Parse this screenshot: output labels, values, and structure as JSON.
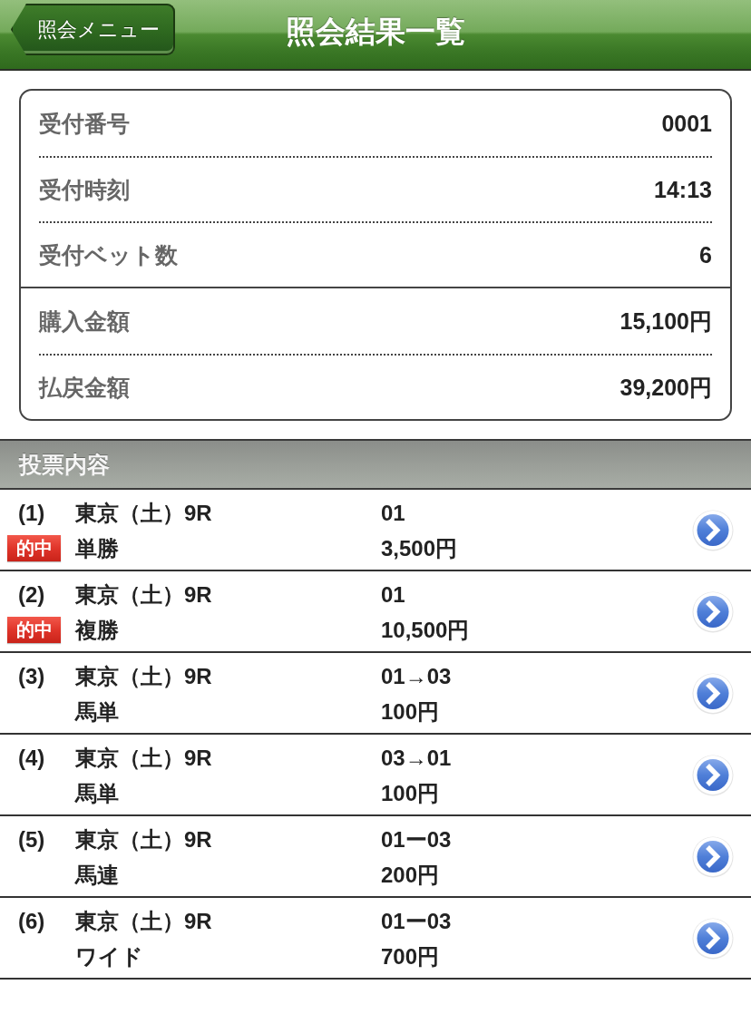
{
  "header": {
    "back_button": "照会メニュー",
    "title": "照会結果一覧"
  },
  "summary": {
    "groups": [
      {
        "rows": [
          {
            "label": "受付番号",
            "value": "0001"
          },
          {
            "label": "受付時刻",
            "value": "14:13"
          },
          {
            "label": "受付ベット数",
            "value": "6"
          }
        ]
      },
      {
        "rows": [
          {
            "label": "購入金額",
            "value": "15,100円"
          },
          {
            "label": "払戻金額",
            "value": "39,200円"
          }
        ]
      }
    ]
  },
  "section": {
    "title": "投票内容"
  },
  "bets": [
    {
      "number": "(1)",
      "badge": "的中",
      "venue": "東京（土）9R",
      "bet_type": "単勝",
      "combination": "01",
      "amount": "3,500円"
    },
    {
      "number": "(2)",
      "badge": "的中",
      "venue": "東京（土）9R",
      "bet_type": "複勝",
      "combination": "01",
      "amount": "10,500円"
    },
    {
      "number": "(3)",
      "venue": "東京（土）9R",
      "bet_type": "馬単",
      "combination": "01→03",
      "amount": "100円"
    },
    {
      "number": "(4)",
      "venue": "東京（土）9R",
      "bet_type": "馬単",
      "combination": "03→01",
      "amount": "100円"
    },
    {
      "number": "(5)",
      "venue": "東京（土）9R",
      "bet_type": "馬連",
      "combination": "01ー03",
      "amount": "200円"
    },
    {
      "number": "(6)",
      "venue": "東京（土）9R",
      "bet_type": "ワイド",
      "combination": "01ー03",
      "amount": "700円"
    }
  ]
}
